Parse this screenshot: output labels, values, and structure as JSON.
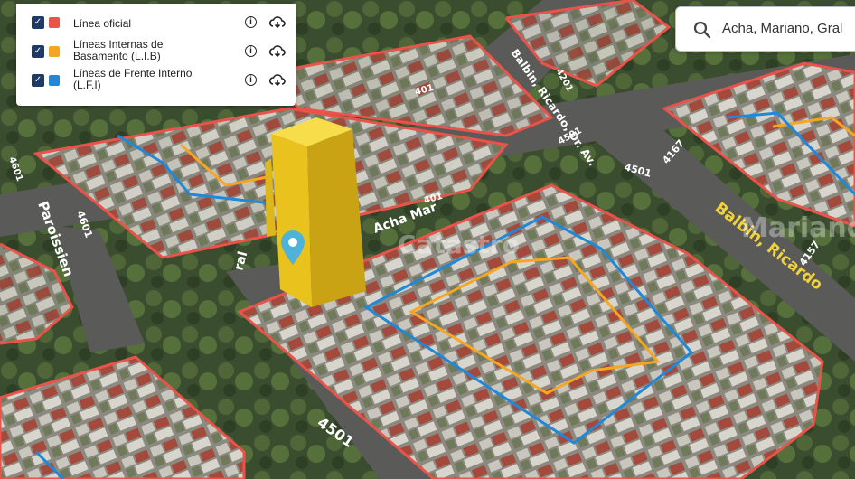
{
  "legend": {
    "items": [
      {
        "label": "Línea oficial",
        "color": "#e8534a",
        "checked": true
      },
      {
        "label": "Líneas Internas de Basamento (L.I.B)",
        "color": "#f5a623",
        "checked": true
      },
      {
        "label": "Líneas de Frente Interno (L.F.I)",
        "color": "#1f88d9",
        "checked": true
      }
    ],
    "info_icon": "info-icon",
    "download_icon": "cloud-download-icon"
  },
  "search": {
    "value": "Acha, Mariano, Gral",
    "icon": "search-icon"
  },
  "map": {
    "streets": {
      "balbin_vertical": "Balbin, Ricardo, Dr. Av.",
      "balbin_right": "Balbin, Ricardo",
      "acha": "Acha Mar",
      "paroissien": "Paroissien",
      "ral": "ral"
    },
    "block_numbers": [
      "4501",
      "4167",
      "4501",
      "4601",
      "4157",
      "4601",
      "4501",
      "4201",
      "401",
      "401"
    ],
    "watermarks": [
      "Mariano",
      "Catastro"
    ],
    "colors": {
      "linea_oficial": "#e8534a",
      "lib": "#f5a623",
      "lfi": "#1f88d9",
      "building": "#f1cc1f",
      "pin": "#4fb3d9"
    }
  }
}
